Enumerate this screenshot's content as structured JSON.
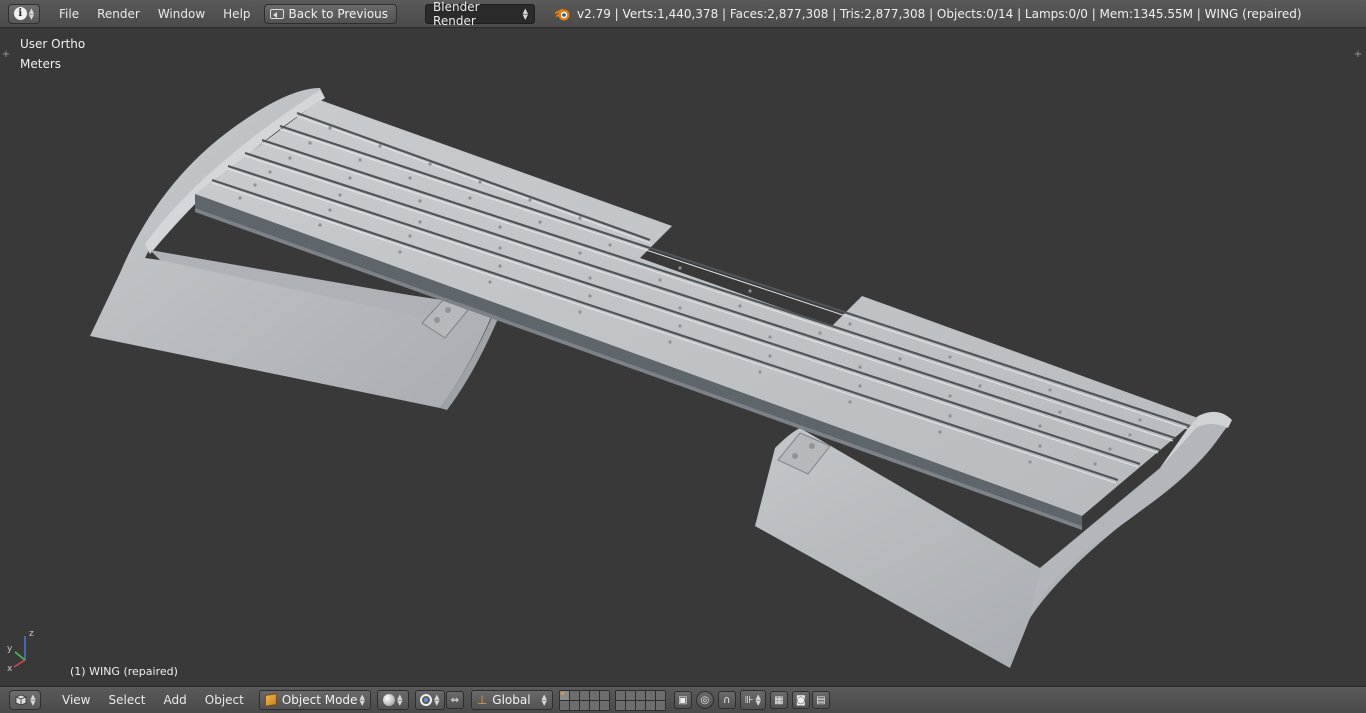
{
  "header": {
    "editor_type_icon": "info-icon",
    "menu": [
      "File",
      "Render",
      "Window",
      "Help"
    ],
    "back_button": "Back to Previous",
    "render_engine": "Blender Render",
    "stats": "v2.79 | Verts:1,440,378 | Faces:2,877,308 | Tris:2,877,308 | Objects:0/14 | Lamps:0/0 | Mem:1345.55M | WING (repaired)"
  },
  "viewport": {
    "view_name": "User Ortho",
    "units": "Meters",
    "active_object": "(1) WING (repaired)",
    "axis_labels": {
      "x": "x",
      "y": "y",
      "z": "z"
    }
  },
  "footer": {
    "editor_type_icon": "3d-view-icon",
    "menu": [
      "View",
      "Select",
      "Add",
      "Object"
    ],
    "mode": "Object Mode",
    "orientation": "Global"
  },
  "colors": {
    "viewport_bg": "#393939",
    "header_bg": "#4f4f4f",
    "model_surface": "#b9bdc0",
    "model_shadow": "#5f666b",
    "accent_orange": "#e89a3a"
  }
}
